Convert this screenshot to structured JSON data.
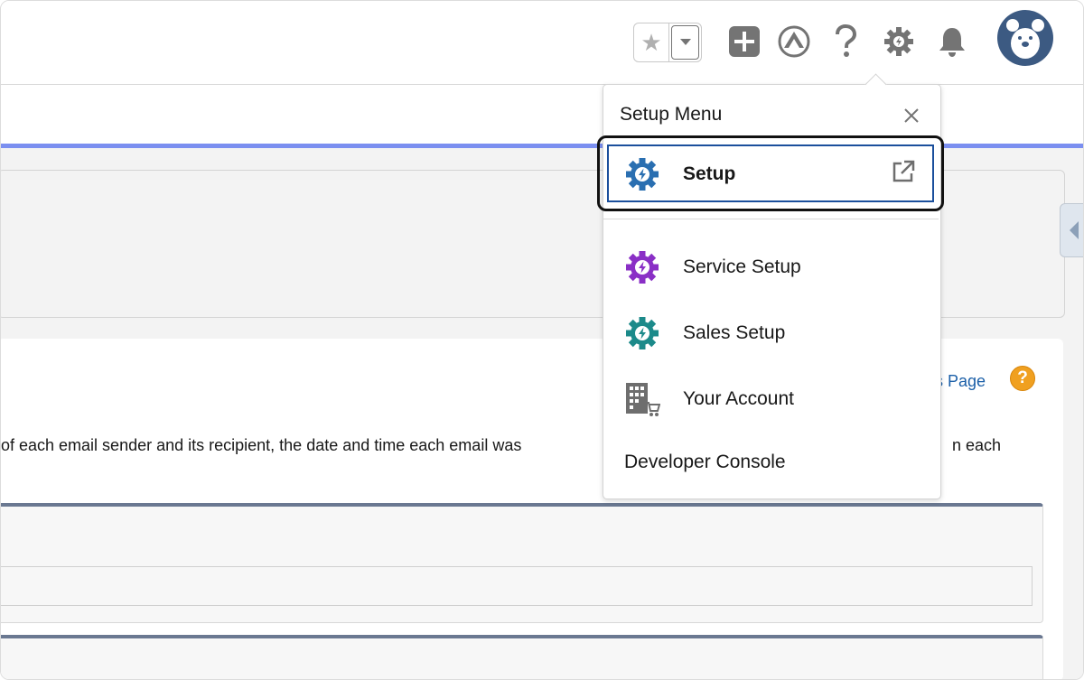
{
  "header": {
    "favorites_icon": "star-icon",
    "favorites_dropdown_icon": "caret-down-icon",
    "global_actions_icon": "plus-icon",
    "trailhead_icon": "trailhead-icon",
    "help_icon": "question-icon",
    "setup_icon": "gear-icon",
    "notifications_icon": "bell-icon",
    "avatar_icon": "bear-avatar-icon"
  },
  "setup_menu": {
    "title": "Setup Menu",
    "close_icon": "close-icon",
    "items": [
      {
        "label": "Setup",
        "icon": "gear-bolt-icon",
        "color": "#2a6fb1",
        "external_icon": "external-link-icon"
      },
      {
        "label": "Service Setup",
        "icon": "gear-bolt-icon",
        "color": "#8a2fc6"
      },
      {
        "label": "Sales Setup",
        "icon": "gear-bolt-icon",
        "color": "#1c8a8a"
      },
      {
        "label": "Your Account",
        "icon": "building-cart-icon",
        "color": "#6e6e6e"
      },
      {
        "label": "Developer Console"
      }
    ]
  },
  "content": {
    "help_link": "nis Page",
    "help_badge": "?",
    "description_left": "of each email sender and its recipient, the date and time each email was",
    "description_right": "n each"
  },
  "colors": {
    "accent_bar": "#7b8ff0",
    "section_border": "#6a7891",
    "highlight": "#1b4f9c",
    "link": "#1b5fa8"
  }
}
